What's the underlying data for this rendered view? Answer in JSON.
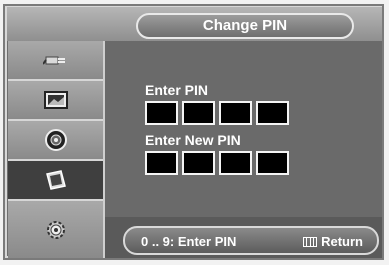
{
  "title": "Change PIN",
  "sidebar": {
    "items": [
      {
        "icon": "plug-icon"
      },
      {
        "icon": "picture-icon"
      },
      {
        "icon": "sound-icon"
      },
      {
        "icon": "channel-icon"
      },
      {
        "icon": "setup-gear-icon"
      }
    ],
    "active_index": 3
  },
  "form": {
    "enter_pin_label": "Enter PIN",
    "enter_new_pin_label": "Enter New PIN",
    "enter_pin_digits": [
      "",
      "",
      "",
      ""
    ],
    "new_pin_digits": [
      "",
      "",
      "",
      ""
    ]
  },
  "help": {
    "digits_hint": "0 .. 9: Enter PIN",
    "menu_icon": "menu-icon",
    "return_label": "Return"
  },
  "colors": {
    "panel": "#6a6a6a",
    "sidebar": "#8c8c8c",
    "active_item": "#3f3f3f",
    "pin_box": "#000000",
    "text": "#ffffff"
  }
}
